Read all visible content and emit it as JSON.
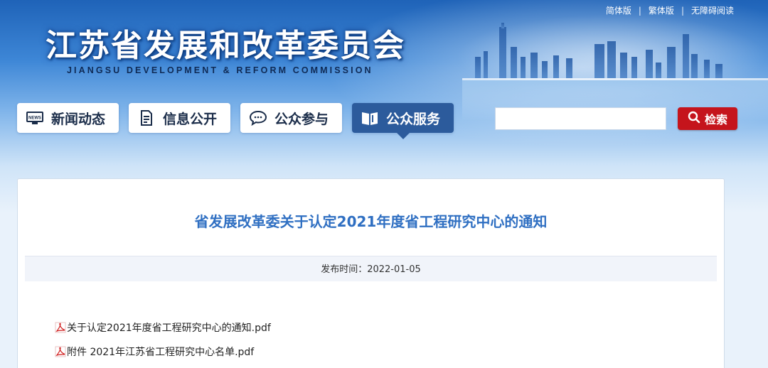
{
  "header": {
    "org_name_cn": "江苏省发展和改革委员会",
    "org_name_en": "JIANGSU DEVELOPMENT & REFORM COMMISSION",
    "top_links": [
      "简体版",
      "繁体版",
      "无障碍阅读"
    ],
    "separator": "|"
  },
  "nav": {
    "items": [
      {
        "label": "新闻动态",
        "icon": "news-icon"
      },
      {
        "label": "信息公开",
        "icon": "document-icon"
      },
      {
        "label": "公众参与",
        "icon": "chat-bubble-icon"
      },
      {
        "label": "公众服务",
        "icon": "book-icon",
        "active": true
      }
    ]
  },
  "search": {
    "placeholder": "",
    "button_label": "检索"
  },
  "article": {
    "title": "省发展改革委关于认定2021年度省工程研究中心的通知",
    "publish_label": "发布时间：2022-01-05",
    "attachments": [
      {
        "name": "关于认定2021年度省工程研究中心的通知.pdf",
        "icon": "pdf-icon"
      },
      {
        "name": "附件 2021年江苏省工程研究中心名单.pdf",
        "icon": "pdf-icon"
      }
    ]
  },
  "colors": {
    "accent_title": "#2f6fc2",
    "nav_active": "#2c5b9c",
    "search_button": "#c5141c"
  }
}
